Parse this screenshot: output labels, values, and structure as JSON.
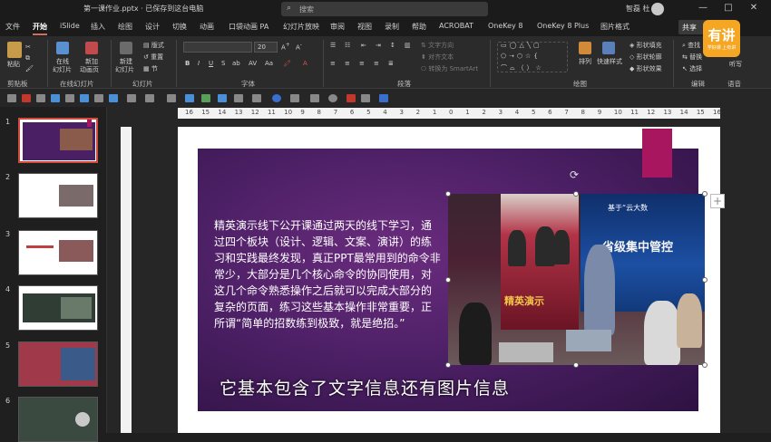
{
  "window": {
    "title": "第一课作业.pptx · 已保存到这台电脑",
    "search_placeholder": "搜索",
    "user_name": "智磊 杜",
    "controls": [
      "—",
      "□",
      "✕"
    ]
  },
  "tabs": [
    {
      "label": "文件"
    },
    {
      "label": "开始",
      "active": true
    },
    {
      "label": "iSlide"
    },
    {
      "label": "插入"
    },
    {
      "label": "绘图"
    },
    {
      "label": "设计"
    },
    {
      "label": "切换"
    },
    {
      "label": "动画"
    },
    {
      "label": "口袋动画 PA"
    },
    {
      "label": "幻灯片放映"
    },
    {
      "label": "审阅"
    },
    {
      "label": "视图"
    },
    {
      "label": "录制"
    },
    {
      "label": "帮助"
    },
    {
      "label": "ACROBAT"
    },
    {
      "label": "OneKey 8"
    },
    {
      "label": "OneKey 8 Plus"
    },
    {
      "label": "图片格式"
    }
  ],
  "share_label": "共享",
  "ribbon": {
    "clipboard": {
      "paste": "粘贴",
      "group": "剪贴板"
    },
    "online_slides": {
      "online": "在线",
      "online2": "幻灯片",
      "new": "新加",
      "new2": "动画页",
      "group": "在线幻灯片"
    },
    "slides": {
      "new_slide": "新建",
      "new_slide2": "幻灯片",
      "layout": "版式",
      "reset": "重置",
      "section": "节",
      "group": "幻灯片"
    },
    "font": {
      "size": "20",
      "group": "字体"
    },
    "paragraph": {
      "text_direction": "文字方向",
      "align_text": "对齐文本",
      "smartart": "转换为 SmartArt",
      "group": "段落"
    },
    "drawing": {
      "arrange": "排列",
      "quick_styles": "快速样式",
      "fill": "形状填充",
      "outline": "形状轮廓",
      "effects": "形状效果",
      "group": "绘图"
    },
    "editing": {
      "find": "查找",
      "replace": "替换",
      "select": "选择",
      "group": "编辑"
    },
    "voice": {
      "dictate": "听写",
      "group": "语音"
    }
  },
  "ruler_labels": [
    "16",
    "15",
    "14",
    "13",
    "12",
    "11",
    "10",
    "9",
    "8",
    "7",
    "6",
    "5",
    "4",
    "3",
    "2",
    "1",
    "0",
    "1",
    "2",
    "3",
    "4",
    "5",
    "6",
    "7",
    "8",
    "9",
    "10",
    "11",
    "12",
    "13",
    "14",
    "15",
    "16"
  ],
  "slides": [
    {
      "number": "1"
    },
    {
      "number": "2"
    },
    {
      "number": "3"
    },
    {
      "number": "4"
    },
    {
      "number": "5"
    },
    {
      "number": "6"
    }
  ],
  "slide": {
    "body_text": "精英演示线下公开课通过两天的线下学习，通过四个板块（设计、逻辑、文案、演讲）的练习和实践最终发现，真正PPT最常用到的命令非常少，大部分是几个核心命令的协同使用，对这几个命令熟悉操作之后就可以完成大部分的复杂的页面，练习这些基本操作非常重要，正所谓“简单的招数练到极致，就是绝招。”",
    "photo_banner_text": "省级集中管控",
    "photo_banner_text2": "精英演示",
    "photo_top_text": "基于“云大数"
  },
  "subtitle": "它基本包含了文字信息还有图片信息",
  "watermark": {
    "big": "有讲",
    "small": "学好课 上有讲"
  },
  "colors": {
    "accent": "#d24a3c",
    "slide_bg": "#4b1f64",
    "ribbon_mark": "#a8165f"
  }
}
